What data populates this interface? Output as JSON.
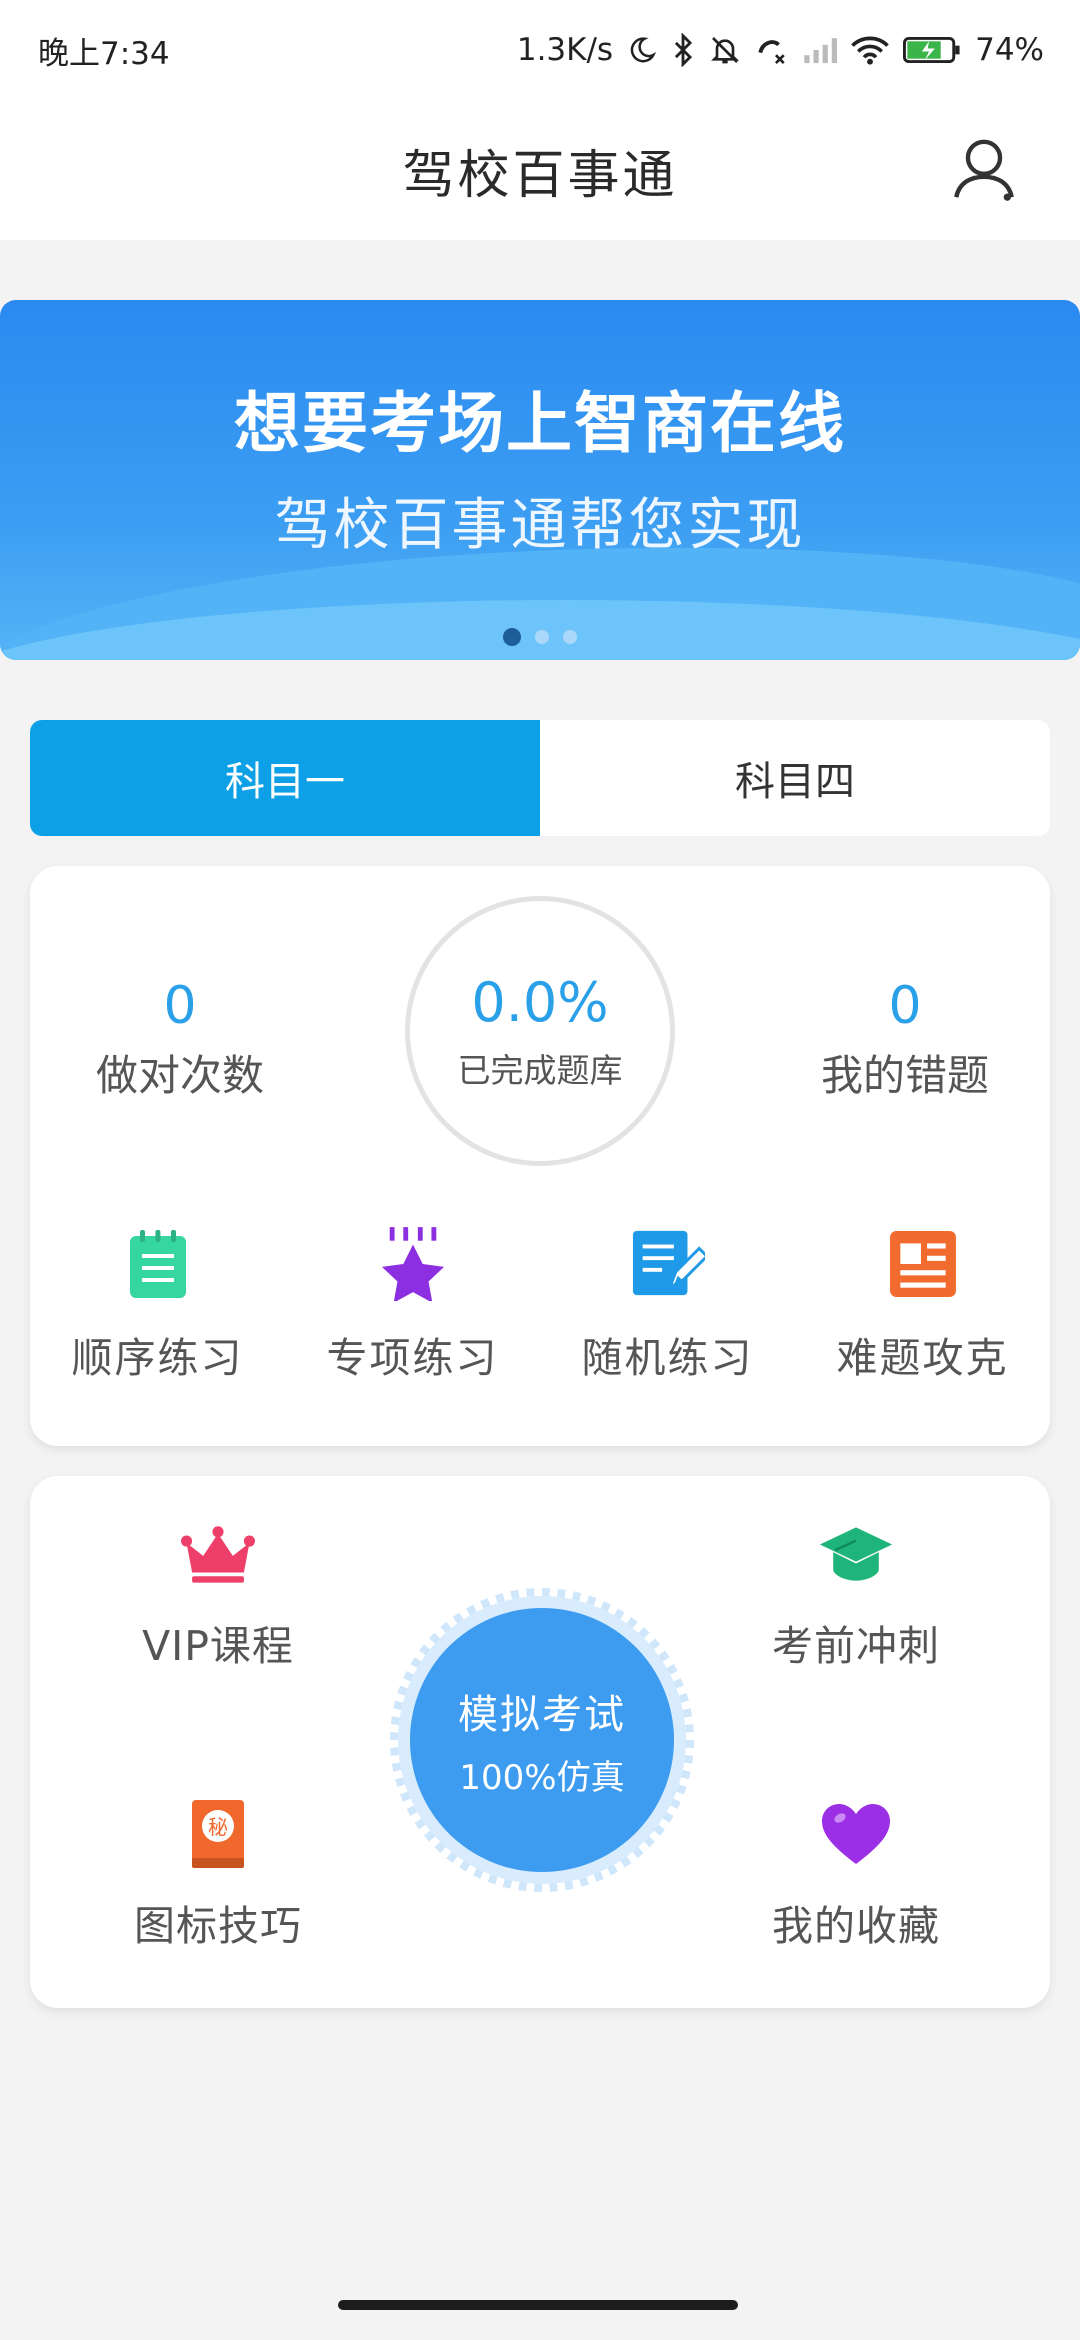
{
  "status_bar": {
    "time": "晚上7:34",
    "net_speed": "1.3K/s",
    "battery": "74%",
    "icons": [
      "moon-icon",
      "bluetooth-icon",
      "mute-bell-icon",
      "call-forward-icon",
      "signal-icon",
      "wifi-icon",
      "battery-icon"
    ]
  },
  "header": {
    "title": "驾校百事通",
    "user_icon": "user-icon"
  },
  "banner": {
    "headline": "想要考场上智商在线",
    "subline": "驾校百事通帮您实现",
    "page_count": 3,
    "active_index": 0
  },
  "tabs": [
    {
      "label": "科目一",
      "active": true
    },
    {
      "label": "科目四",
      "active": false
    }
  ],
  "stats": {
    "correct_count": "0",
    "correct_label": "做对次数",
    "progress_value": "0.0%",
    "progress_label": "已完成题库",
    "wrong_count": "0",
    "wrong_label": "我的错题"
  },
  "practice": [
    {
      "label": "顺序练习",
      "icon": "notebook-icon",
      "color": "#36d6a0"
    },
    {
      "label": "专项练习",
      "icon": "star-icon",
      "color": "#8b2fe0"
    },
    {
      "label": "随机练习",
      "icon": "edit-document-icon",
      "color": "#1e9ae8"
    },
    {
      "label": "难题攻克",
      "icon": "article-icon",
      "color": "#f26b2e"
    }
  ],
  "exam": {
    "vip_label": "VIP课程",
    "sprint_label": "考前冲刺",
    "tips_label": "图标技巧",
    "favorites_label": "我的收藏",
    "mock_line1": "模拟考试",
    "mock_line2": "100%仿真",
    "tips_badge": "秘",
    "colors": {
      "vip": "#ee3f6a",
      "sprint": "#1fb57a",
      "tips": "#f0682c",
      "favorites": "#9b2fe6",
      "mock": "#3d9cf0"
    }
  },
  "theme": {
    "accent": "#0ea0e6",
    "number_color": "#2aa0e8"
  }
}
